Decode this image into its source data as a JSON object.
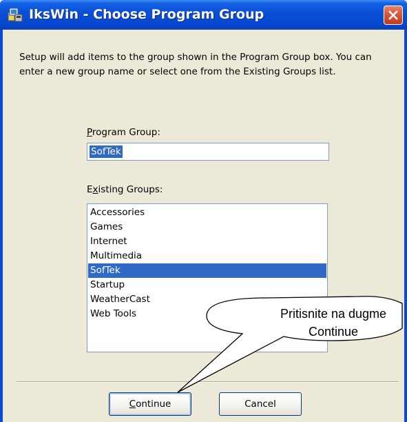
{
  "window": {
    "title": "IksWin - Choose Program Group",
    "icon": "setup-app-icon",
    "close_icon": "close-icon"
  },
  "description": "Setup will add items to the group shown in the Program Group box. You can enter a new group name or select one from the Existing Groups list.",
  "program_group": {
    "label_prefix": "",
    "label_mnemonic": "P",
    "label_rest": "rogram Group:",
    "value": "SofTek"
  },
  "existing_groups": {
    "label_prefix": "E",
    "label_mnemonic": "x",
    "label_rest": "isting Groups:",
    "items": [
      "Accessories",
      "Games",
      "Internet",
      "Multimedia",
      "SofTek",
      "Startup",
      "WeatherCast",
      "Web Tools"
    ],
    "selected": "SofTek"
  },
  "buttons": {
    "continue_mnemonic": "C",
    "continue_rest": "ontinue",
    "cancel": "Cancel"
  },
  "callout": {
    "line1": "Pritisnite na dugme",
    "line2": "Continue"
  },
  "colors": {
    "titlebar": "#0a50d6",
    "selection": "#316ac5",
    "dialog_bg": "#ece9d8",
    "close_button": "#d85a3c"
  }
}
